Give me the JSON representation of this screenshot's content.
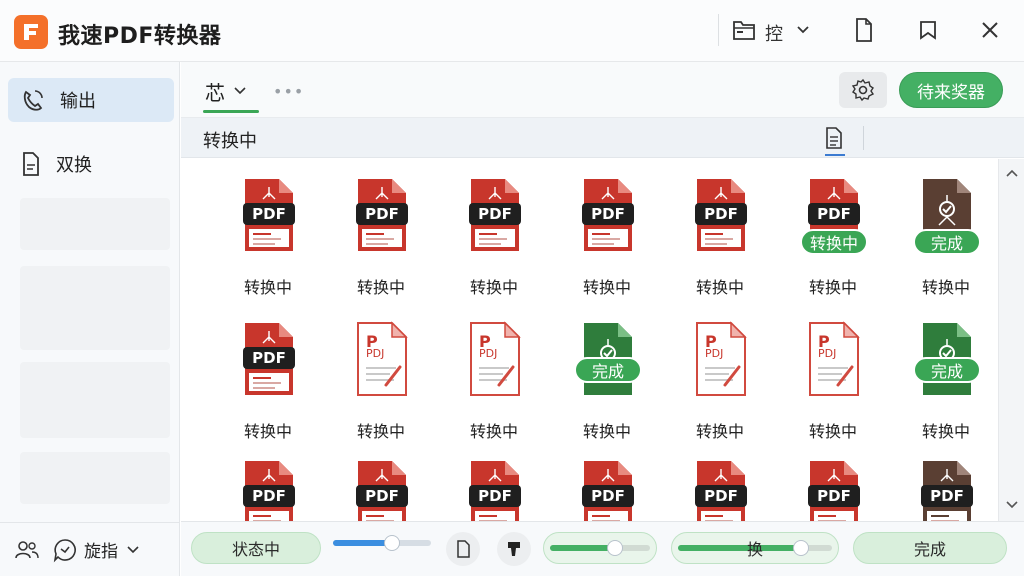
{
  "window": {
    "app_title": "我速PDF转换器",
    "folder_label": "控",
    "accent": "#44b064",
    "brand": "#f4702a"
  },
  "sidebar": {
    "items": [
      {
        "label": "输出",
        "icon": "phone-rotate-icon",
        "active": true
      },
      {
        "label": "双换",
        "icon": "document-icon",
        "active": false
      }
    ],
    "bottom_label": "旋指"
  },
  "toolbar": {
    "sort_label": "芯",
    "more": "•••",
    "primary_button": "待来奖器"
  },
  "section": {
    "title": "转换中"
  },
  "files": [
    {
      "name": "转换中",
      "kind": "pdf",
      "badge": ""
    },
    {
      "name": "转换中",
      "kind": "pdf",
      "badge": ""
    },
    {
      "name": "转换中",
      "kind": "pdf",
      "badge": ""
    },
    {
      "name": "转换中",
      "kind": "pdf",
      "badge": ""
    },
    {
      "name": "转换中",
      "kind": "pdf",
      "badge": ""
    },
    {
      "name": "转换中",
      "kind": "pdf",
      "badge": "转换中"
    },
    {
      "name": "转换中",
      "kind": "brown",
      "badge": "完成"
    },
    {
      "name": "转换中",
      "kind": "pdf",
      "badge": ""
    },
    {
      "name": "转换中",
      "kind": "ppt",
      "badge": ""
    },
    {
      "name": "转换中",
      "kind": "ppt",
      "badge": ""
    },
    {
      "name": "转换中",
      "kind": "green",
      "badge": "完成"
    },
    {
      "name": "转换中",
      "kind": "ppt",
      "badge": ""
    },
    {
      "name": "转换中",
      "kind": "ppt",
      "badge": ""
    },
    {
      "name": "转换中",
      "kind": "green",
      "badge": "完成"
    },
    {
      "name": "",
      "kind": "pdf",
      "badge": ""
    },
    {
      "name": "",
      "kind": "pdf",
      "badge": ""
    },
    {
      "name": "",
      "kind": "pdf",
      "badge": ""
    },
    {
      "name": "",
      "kind": "pdf",
      "badge": ""
    },
    {
      "name": "",
      "kind": "pdf",
      "badge": ""
    },
    {
      "name": "",
      "kind": "pdf",
      "badge": ""
    },
    {
      "name": "",
      "kind": "brownpdf",
      "badge": ""
    }
  ],
  "pdf_text": "PDF",
  "ppt_text": "PDJ",
  "bottom": {
    "status_pill": "状态中",
    "slider1_level": 0.6,
    "slider2_level": 0.65,
    "convert_label": "换",
    "slider3_level": 0.8,
    "done_label": "完成"
  }
}
